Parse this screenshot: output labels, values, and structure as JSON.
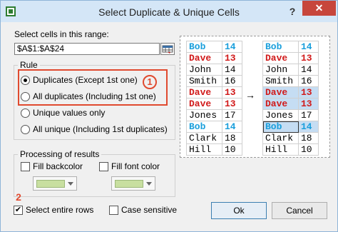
{
  "window": {
    "title": "Select Duplicate & Unique Cells",
    "help_glyph": "?",
    "close_glyph": "✕"
  },
  "range": {
    "label": "Select cells in this range:",
    "value": "$A$1:$A$24"
  },
  "rule": {
    "legend": "Rule",
    "badge": "1",
    "options": [
      {
        "label": "Duplicates (Except 1st one)",
        "checked": true
      },
      {
        "label": "All duplicates (Including 1st one)",
        "checked": false
      },
      {
        "label": "Unique values only",
        "checked": false
      },
      {
        "label": "All unique (Including 1st duplicates)",
        "checked": false
      }
    ]
  },
  "processing": {
    "legend": "Processing of results",
    "fill_backcolor": "Fill backcolor",
    "fill_font_color": "Fill font color",
    "swatch_color": "#c8dfa0"
  },
  "bottom": {
    "badge": "2",
    "select_entire_rows": "Select entire rows",
    "select_entire_rows_checked": true,
    "case_sensitive": "Case sensitive",
    "case_sensitive_checked": false,
    "ok": "Ok",
    "cancel": "Cancel",
    "check_glyph": "✔"
  },
  "preview": {
    "arrow": "→",
    "before": [
      {
        "name": "Bob",
        "num": "14",
        "style": "first"
      },
      {
        "name": "Dave",
        "num": "13",
        "style": "dup"
      },
      {
        "name": "John",
        "num": "14",
        "style": ""
      },
      {
        "name": "Smith",
        "num": "16",
        "style": ""
      },
      {
        "name": "Dave",
        "num": "13",
        "style": "dup"
      },
      {
        "name": "Dave",
        "num": "13",
        "style": "dup"
      },
      {
        "name": "Jones",
        "num": "17",
        "style": ""
      },
      {
        "name": "Bob",
        "num": "14",
        "style": "first"
      },
      {
        "name": "Clark",
        "num": "18",
        "style": ""
      },
      {
        "name": "Hill",
        "num": "10",
        "style": ""
      }
    ],
    "after": [
      {
        "name": "Bob",
        "num": "14",
        "style": "first",
        "selected": false
      },
      {
        "name": "Dave",
        "num": "13",
        "style": "dup",
        "selected": false
      },
      {
        "name": "John",
        "num": "14",
        "style": "",
        "selected": false
      },
      {
        "name": "Smith",
        "num": "16",
        "style": "",
        "selected": false
      },
      {
        "name": "Dave",
        "num": "13",
        "style": "dup",
        "selected": true
      },
      {
        "name": "Dave",
        "num": "13",
        "style": "dup",
        "selected": true
      },
      {
        "name": "Jones",
        "num": "17",
        "style": "",
        "selected": false
      },
      {
        "name": "Bob",
        "num": "14",
        "style": "first",
        "selected": true
      },
      {
        "name": "Clark",
        "num": "18",
        "style": "",
        "selected": false
      },
      {
        "name": "Hill",
        "num": "10",
        "style": "",
        "selected": false
      }
    ]
  },
  "colors": {
    "duplicate_red": "#d11a1a",
    "first_blue": "#1a9fdc",
    "selection_blue": "#c5ddf3",
    "highlight_red": "#e04a2f"
  }
}
